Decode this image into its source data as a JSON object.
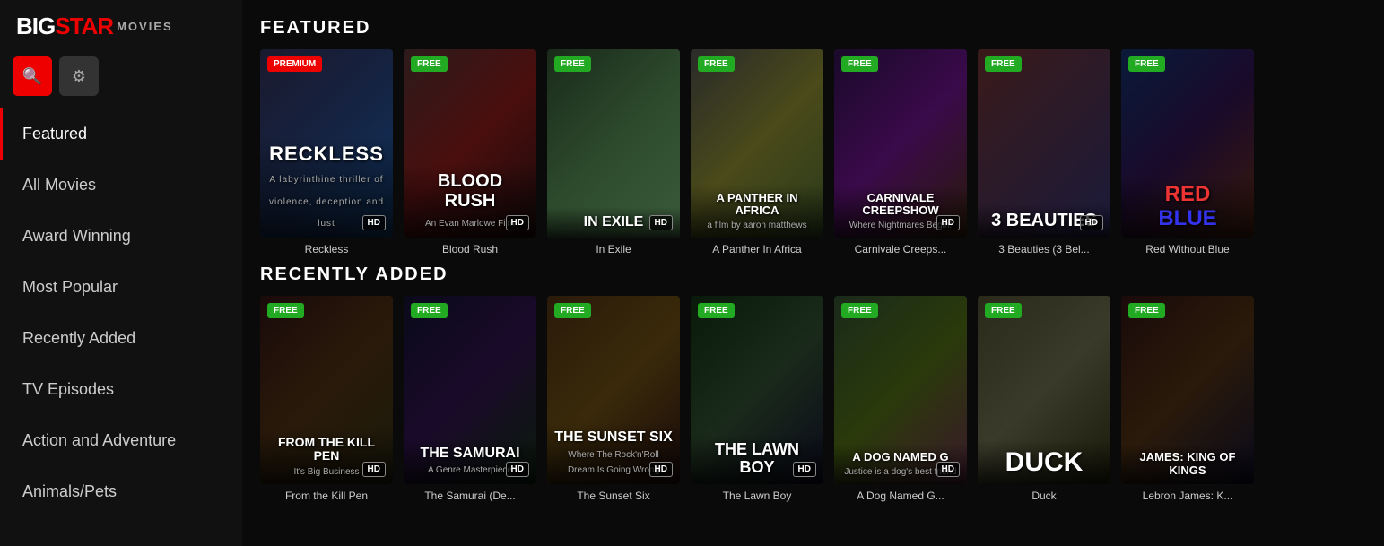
{
  "logo": {
    "big": "BIGSTAR",
    "movies": "MOVIES"
  },
  "nav": {
    "items": [
      {
        "id": "featured",
        "label": "Featured",
        "active": true
      },
      {
        "id": "all-movies",
        "label": "All Movies",
        "active": false
      },
      {
        "id": "award-winning",
        "label": "Award Winning",
        "active": false
      },
      {
        "id": "most-popular",
        "label": "Most Popular",
        "active": false
      },
      {
        "id": "recently-added",
        "label": "Recently Added",
        "active": false
      },
      {
        "id": "tv-episodes",
        "label": "TV Episodes",
        "active": false
      },
      {
        "id": "action-adventure",
        "label": "Action and Adventure",
        "active": false
      },
      {
        "id": "animals-pets",
        "label": "Animals/Pets",
        "active": false
      }
    ]
  },
  "sections": [
    {
      "id": "featured",
      "title": "FEATURED",
      "movies": [
        {
          "id": "reckless",
          "title": "Reckless",
          "badge": "PREMIUM",
          "badge_type": "premium",
          "hd": true,
          "poster_class": "poster-reckless",
          "poster_text": "RECKLESS",
          "poster_sub": "A labyrinthine thriller of violence, deception and lust"
        },
        {
          "id": "blood-rush",
          "title": "Blood Rush",
          "badge": "FREE",
          "badge_type": "free",
          "hd": true,
          "poster_class": "poster-bloodrush",
          "poster_text": "BLOOD RUSH",
          "poster_sub": "An Evan Marlowe Film"
        },
        {
          "id": "in-exile",
          "title": "In Exile",
          "badge": "FREE",
          "badge_type": "free",
          "hd": true,
          "poster_class": "poster-inexile",
          "poster_text": "IN EXILE",
          "poster_sub": ""
        },
        {
          "id": "panther-africa",
          "title": "A Panther In Africa",
          "badge": "FREE",
          "badge_type": "free",
          "hd": false,
          "poster_class": "poster-panther",
          "poster_text": "A PANTHER IN AFRICA",
          "poster_sub": "a film by aaron matthews"
        },
        {
          "id": "carnivale-creepshow",
          "title": "Carnivale Creeps...",
          "badge": "FREE",
          "badge_type": "free",
          "hd": true,
          "poster_class": "poster-carnivale",
          "poster_text": "CARNIVALE CREEPSHOW",
          "poster_sub": "Come on in... Where nightmares begin!"
        },
        {
          "id": "3-beauties",
          "title": "3 Beauties (3 Bel...",
          "badge": "FREE",
          "badge_type": "free",
          "hd": true,
          "poster_class": "poster-beauties",
          "poster_text": "3 BEAUTIES",
          "poster_sub": ""
        },
        {
          "id": "red-without-blue",
          "title": "Red Without Blue",
          "badge": "FREE",
          "badge_type": "free",
          "hd": false,
          "poster_class": "poster-redblue",
          "poster_text": "RED BLUE",
          "poster_sub": ""
        }
      ]
    },
    {
      "id": "recently-added",
      "title": "RECENTLY ADDED",
      "movies": [
        {
          "id": "kill-pen",
          "title": "From the Kill Pen",
          "badge": "FREE",
          "badge_type": "free",
          "hd": true,
          "poster_class": "poster-killpen",
          "poster_text": "FROM THE KILL PEN",
          "poster_sub": "It's Big Business"
        },
        {
          "id": "samurai",
          "title": "The Samurai (De...",
          "badge": "FREE",
          "badge_type": "free",
          "hd": true,
          "poster_class": "poster-samurai",
          "poster_text": "THE SAMURAI",
          "poster_sub": "A Genre Masterpiece"
        },
        {
          "id": "sunset-six",
          "title": "The Sunset Six",
          "badge": "FREE",
          "badge_type": "free",
          "hd": true,
          "poster_class": "poster-sunset",
          "poster_text": "THE SUNSET SIX",
          "poster_sub": "Where The Rock'n'Roll Dream Is Going Wrong"
        },
        {
          "id": "lawn-boy",
          "title": "The Lawn Boy",
          "badge": "FREE",
          "badge_type": "free",
          "hd": true,
          "poster_class": "poster-lawnboy",
          "poster_text": "THE LAWN BOY",
          "poster_sub": ""
        },
        {
          "id": "dog-named",
          "title": "A Dog Named G...",
          "badge": "FREE",
          "badge_type": "free",
          "hd": true,
          "poster_class": "poster-dognamed",
          "poster_text": "A DOG NAMED G",
          "poster_sub": "Justice is a dog's best friend"
        },
        {
          "id": "duck",
          "title": "Duck",
          "badge": "FREE",
          "badge_type": "free",
          "hd": false,
          "poster_class": "poster-duck",
          "poster_text": "DUCK",
          "poster_sub": ""
        },
        {
          "id": "lebron",
          "title": "Lebron James: K...",
          "badge": "FREE",
          "badge_type": "free",
          "hd": false,
          "poster_class": "poster-lebron",
          "poster_text": "JAMES KING OF KINGS",
          "poster_sub": ""
        }
      ]
    }
  ],
  "icons": {
    "search": "🔍",
    "gear": "⚙"
  }
}
